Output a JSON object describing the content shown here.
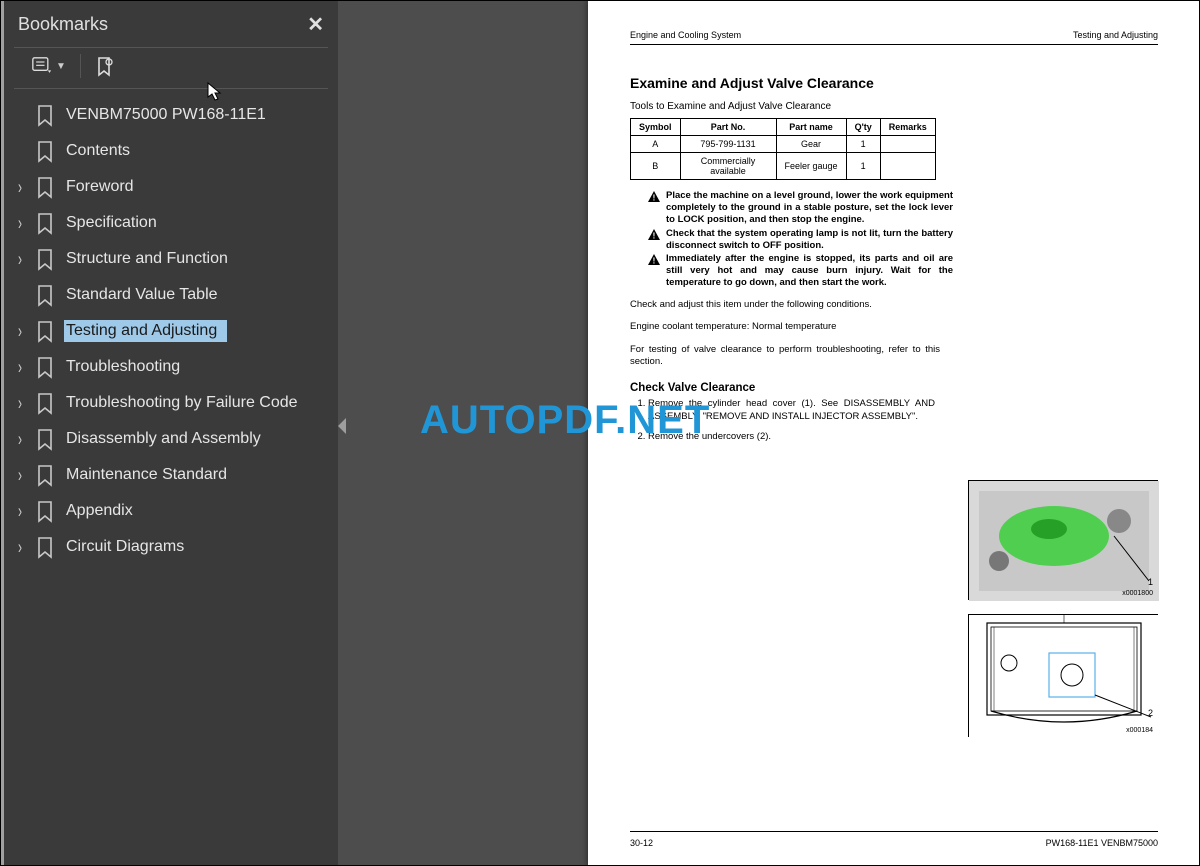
{
  "sidebar": {
    "title": "Bookmarks",
    "items": [
      {
        "label": "VENBM75000 PW168-11E1",
        "expandable": false
      },
      {
        "label": "Contents",
        "expandable": false
      },
      {
        "label": "Foreword",
        "expandable": true
      },
      {
        "label": "Specification",
        "expandable": true
      },
      {
        "label": "Structure and Function",
        "expandable": true
      },
      {
        "label": "Standard Value Table",
        "expandable": false
      },
      {
        "label": "Testing and Adjusting",
        "expandable": true,
        "selected": true
      },
      {
        "label": "Troubleshooting",
        "expandable": true
      },
      {
        "label": "Troubleshooting by Failure Code",
        "expandable": true
      },
      {
        "label": "Disassembly and Assembly",
        "expandable": true
      },
      {
        "label": "Maintenance Standard",
        "expandable": true
      },
      {
        "label": "Appendix",
        "expandable": true
      },
      {
        "label": "Circuit Diagrams",
        "expandable": true
      }
    ]
  },
  "doc": {
    "run_left": "Engine and Cooling System",
    "run_right": "Testing and Adjusting",
    "heading": "Examine and Adjust Valve Clearance",
    "tools_caption": "Tools to Examine and Adjust Valve Clearance",
    "tools_header": [
      "Symbol",
      "Part No.",
      "Part name",
      "Q'ty",
      "Remarks"
    ],
    "tools_rows": [
      [
        "A",
        "795-799-1131",
        "Gear",
        "1",
        ""
      ],
      [
        "B",
        "Commercially available",
        "Feeler gauge",
        "1",
        ""
      ]
    ],
    "warnings": [
      "Place the machine on a level ground, lower the work equipment completely to the ground in a stable posture, set the lock lever to LOCK position, and then stop the engine.",
      "Check that the system operating lamp is not lit, turn the battery disconnect switch to OFF position.",
      "Immediately after the engine is stopped, its parts and oil are still very hot and may cause burn injury. Wait for the temperature to go down, and then start the work."
    ],
    "body1": "Check and adjust this item under the following conditions.",
    "body2": "Engine coolant temperature: Normal temperature",
    "body3": "For testing of valve clearance to perform troubleshooting, refer to this section.",
    "sub_heading": "Check Valve Clearance",
    "steps": [
      "Remove the cylinder head cover (1). See DISASSEMBLY AND ASSEMBLY, \"REMOVE AND INSTALL INJECTOR ASSEMBLY\".",
      "Remove the undercovers (2)."
    ],
    "fig1_id": "x0001800",
    "fig1_num": "1",
    "fig2_id": "x000184",
    "fig2_num": "2",
    "foot_left": "30-12",
    "foot_right": "PW168-11E1   VENBM75000"
  },
  "watermark": "AUTOPDF.NET"
}
